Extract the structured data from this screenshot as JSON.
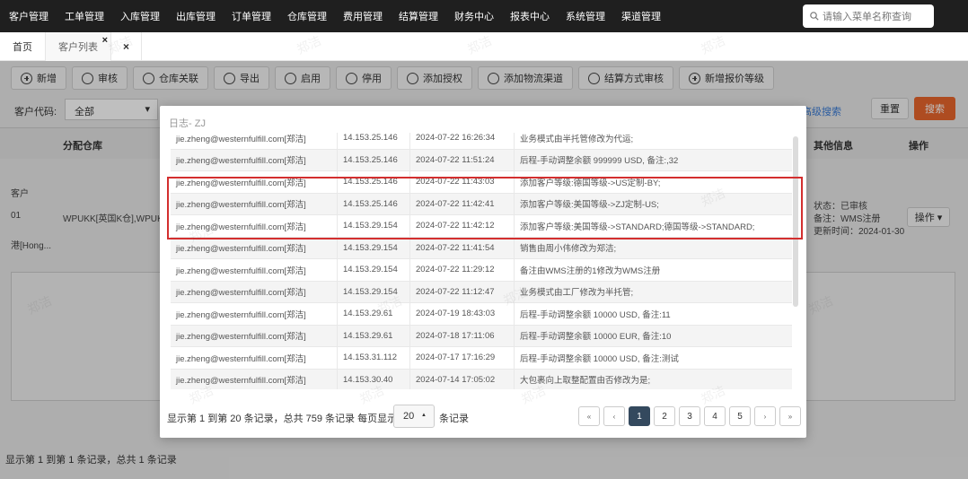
{
  "nav": {
    "menus": [
      "客户管理",
      "工单管理",
      "入库管理",
      "出库管理",
      "订单管理",
      "仓库管理",
      "费用管理",
      "结算管理",
      "财务中心",
      "报表中心",
      "系统管理",
      "渠道管理"
    ],
    "search_placeholder": "请输入菜单名称查询"
  },
  "tabs": {
    "home": "首页",
    "customers": "客户列表",
    "close": "×"
  },
  "toolbar": [
    "新增",
    "审核",
    "仓库关联",
    "导出",
    "启用",
    "停用",
    "添加授权",
    "添加物流渠道",
    "结算方式审核",
    "新增报价等级"
  ],
  "filter": {
    "label": "客户代码:",
    "value": "全部",
    "advanced": "高级搜索",
    "reset": "重置",
    "search": "搜索"
  },
  "grid": {
    "headers": {
      "warehouse": "分配仓库",
      "other": "其他信息",
      "ops": "操作"
    },
    "left_cells": [
      "客户",
      "01",
      "港[Hong..."
    ],
    "warehouse_cell": "WPUKK[英国K仓],WPUK...",
    "other_info": [
      "状态：已审核",
      "备注：WMS注册",
      "更新时间：2024-01-30"
    ],
    "op_label": "操作"
  },
  "footer": "显示第 1 到第 1 条记录，总共 1 条记录",
  "modal": {
    "title": "日志- ZJ",
    "rows": [
      {
        "user": "jie.zheng@westernfulfill.com[郑洁]",
        "ip": "14.153.25.146",
        "time": "2024-07-22 16:26:34",
        "msg": "业务模式由半托管修改为代运;"
      },
      {
        "user": "jie.zheng@westernfulfill.com[郑洁]",
        "ip": "14.153.25.146",
        "time": "2024-07-22 11:51:24",
        "msg": "后程-手动调整余额 999999 USD, 备注:,32"
      },
      {
        "user": "jie.zheng@westernfulfill.com[郑洁]",
        "ip": "14.153.25.146",
        "time": "2024-07-22 11:43:03",
        "msg": "添加客户等级:德国等级->US定制-BY;"
      },
      {
        "user": "jie.zheng@westernfulfill.com[郑洁]",
        "ip": "14.153.25.146",
        "time": "2024-07-22 11:42:41",
        "msg": "添加客户等级:美国等级->ZJ定制-US;"
      },
      {
        "user": "jie.zheng@westernfulfill.com[郑洁]",
        "ip": "14.153.29.154",
        "time": "2024-07-22 11:42:12",
        "msg": "添加客户等级:美国等级->STANDARD;德国等级->STANDARD;"
      },
      {
        "user": "jie.zheng@westernfulfill.com[郑洁]",
        "ip": "14.153.29.154",
        "time": "2024-07-22 11:41:54",
        "msg": "销售由周小伟修改为郑洁;"
      },
      {
        "user": "jie.zheng@westernfulfill.com[郑洁]",
        "ip": "14.153.29.154",
        "time": "2024-07-22 11:29:12",
        "msg": "备注由WMS注册的1修改为WMS注册"
      },
      {
        "user": "jie.zheng@westernfulfill.com[郑洁]",
        "ip": "14.153.29.154",
        "time": "2024-07-22 11:12:47",
        "msg": "业务模式由工厂修改为半托管;"
      },
      {
        "user": "jie.zheng@westernfulfill.com[郑洁]",
        "ip": "14.153.29.61",
        "time": "2024-07-19 18:43:03",
        "msg": "后程-手动调整余额 10000 USD, 备注:11"
      },
      {
        "user": "jie.zheng@westernfulfill.com[郑洁]",
        "ip": "14.153.29.61",
        "time": "2024-07-18 17:11:06",
        "msg": "后程-手动调整余额 10000 EUR, 备注:10"
      },
      {
        "user": "jie.zheng@westernfulfill.com[郑洁]",
        "ip": "14.153.31.112",
        "time": "2024-07-17 17:16:29",
        "msg": "后程-手动调整余额 10000 USD, 备注:测试"
      },
      {
        "user": "jie.zheng@westernfulfill.com[郑洁]",
        "ip": "14.153.30.40",
        "time": "2024-07-14 17:05:02",
        "msg": "大包裹向上取整配置由否修改为是;"
      }
    ],
    "pager_text": "显示第 1 到第 20 条记录，总共 759 条记录 每页显示",
    "page_size": "20",
    "pager_suffix": "条记录",
    "pages": [
      "«",
      "‹",
      "1",
      "2",
      "3",
      "4",
      "5",
      "›",
      "»"
    ],
    "active_page": "1"
  },
  "watermark": "郑洁"
}
